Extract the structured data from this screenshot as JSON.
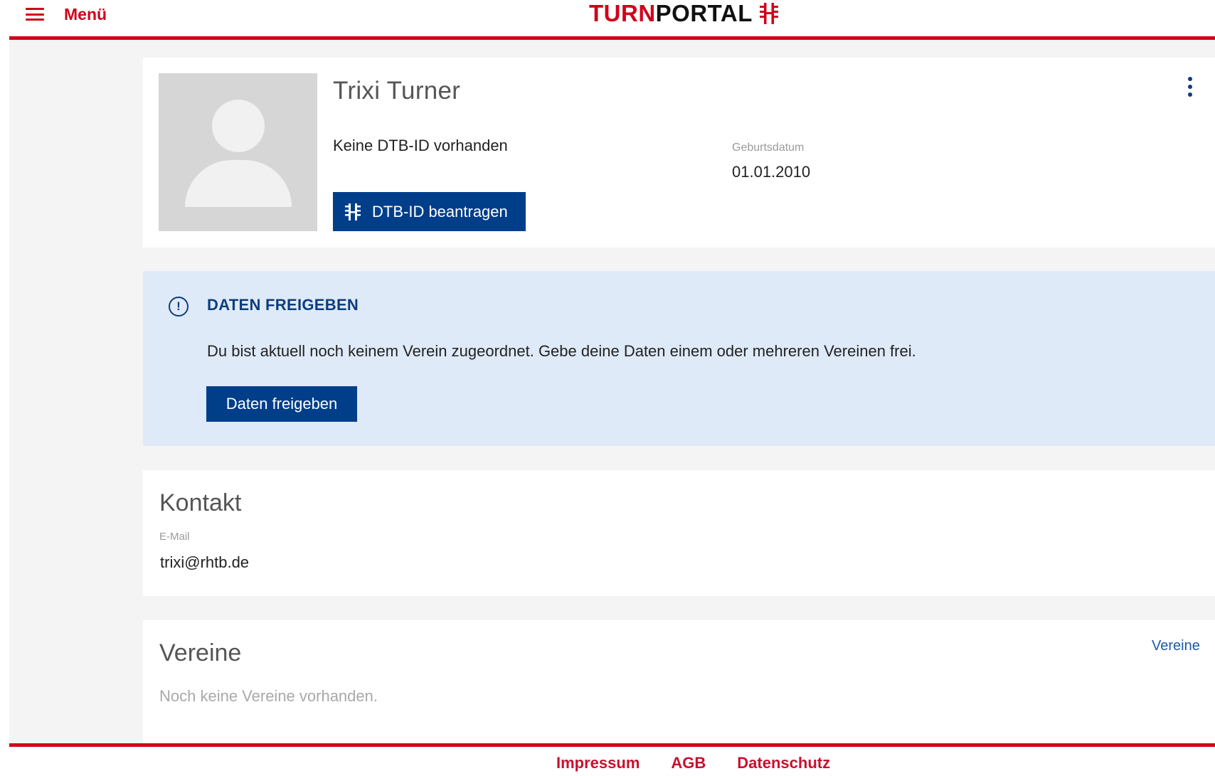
{
  "header": {
    "menu_label": "Menü",
    "logo_part1": "TURN",
    "logo_part2": "PORTAL"
  },
  "profile": {
    "name": "Trixi Turner",
    "id_status": "Keine DTB-ID vorhanden",
    "request_id_button": "DTB-ID beantragen",
    "birthdate_label": "Geburtsdatum",
    "birthdate_value": "01.01.2010"
  },
  "share_notice": {
    "title": "DATEN FREIGEBEN",
    "text": "Du bist aktuell noch keinem Verein zugeordnet. Gebe deine Daten einem oder mehreren Vereinen frei.",
    "button": "Daten freigeben"
  },
  "contact": {
    "title": "Kontakt",
    "email_label": "E-Mail",
    "email_value": "trixi@rhtb.de"
  },
  "clubs": {
    "title": "Vereine",
    "link": "Vereine",
    "empty_text": "Noch keine Vereine vorhanden."
  },
  "footer": {
    "links": [
      "Impressum",
      "AGB",
      "Datenschutz"
    ]
  },
  "colors": {
    "brand_red": "#d0021b",
    "primary_blue": "#003e8a",
    "info_bg": "#dfeaf8"
  }
}
